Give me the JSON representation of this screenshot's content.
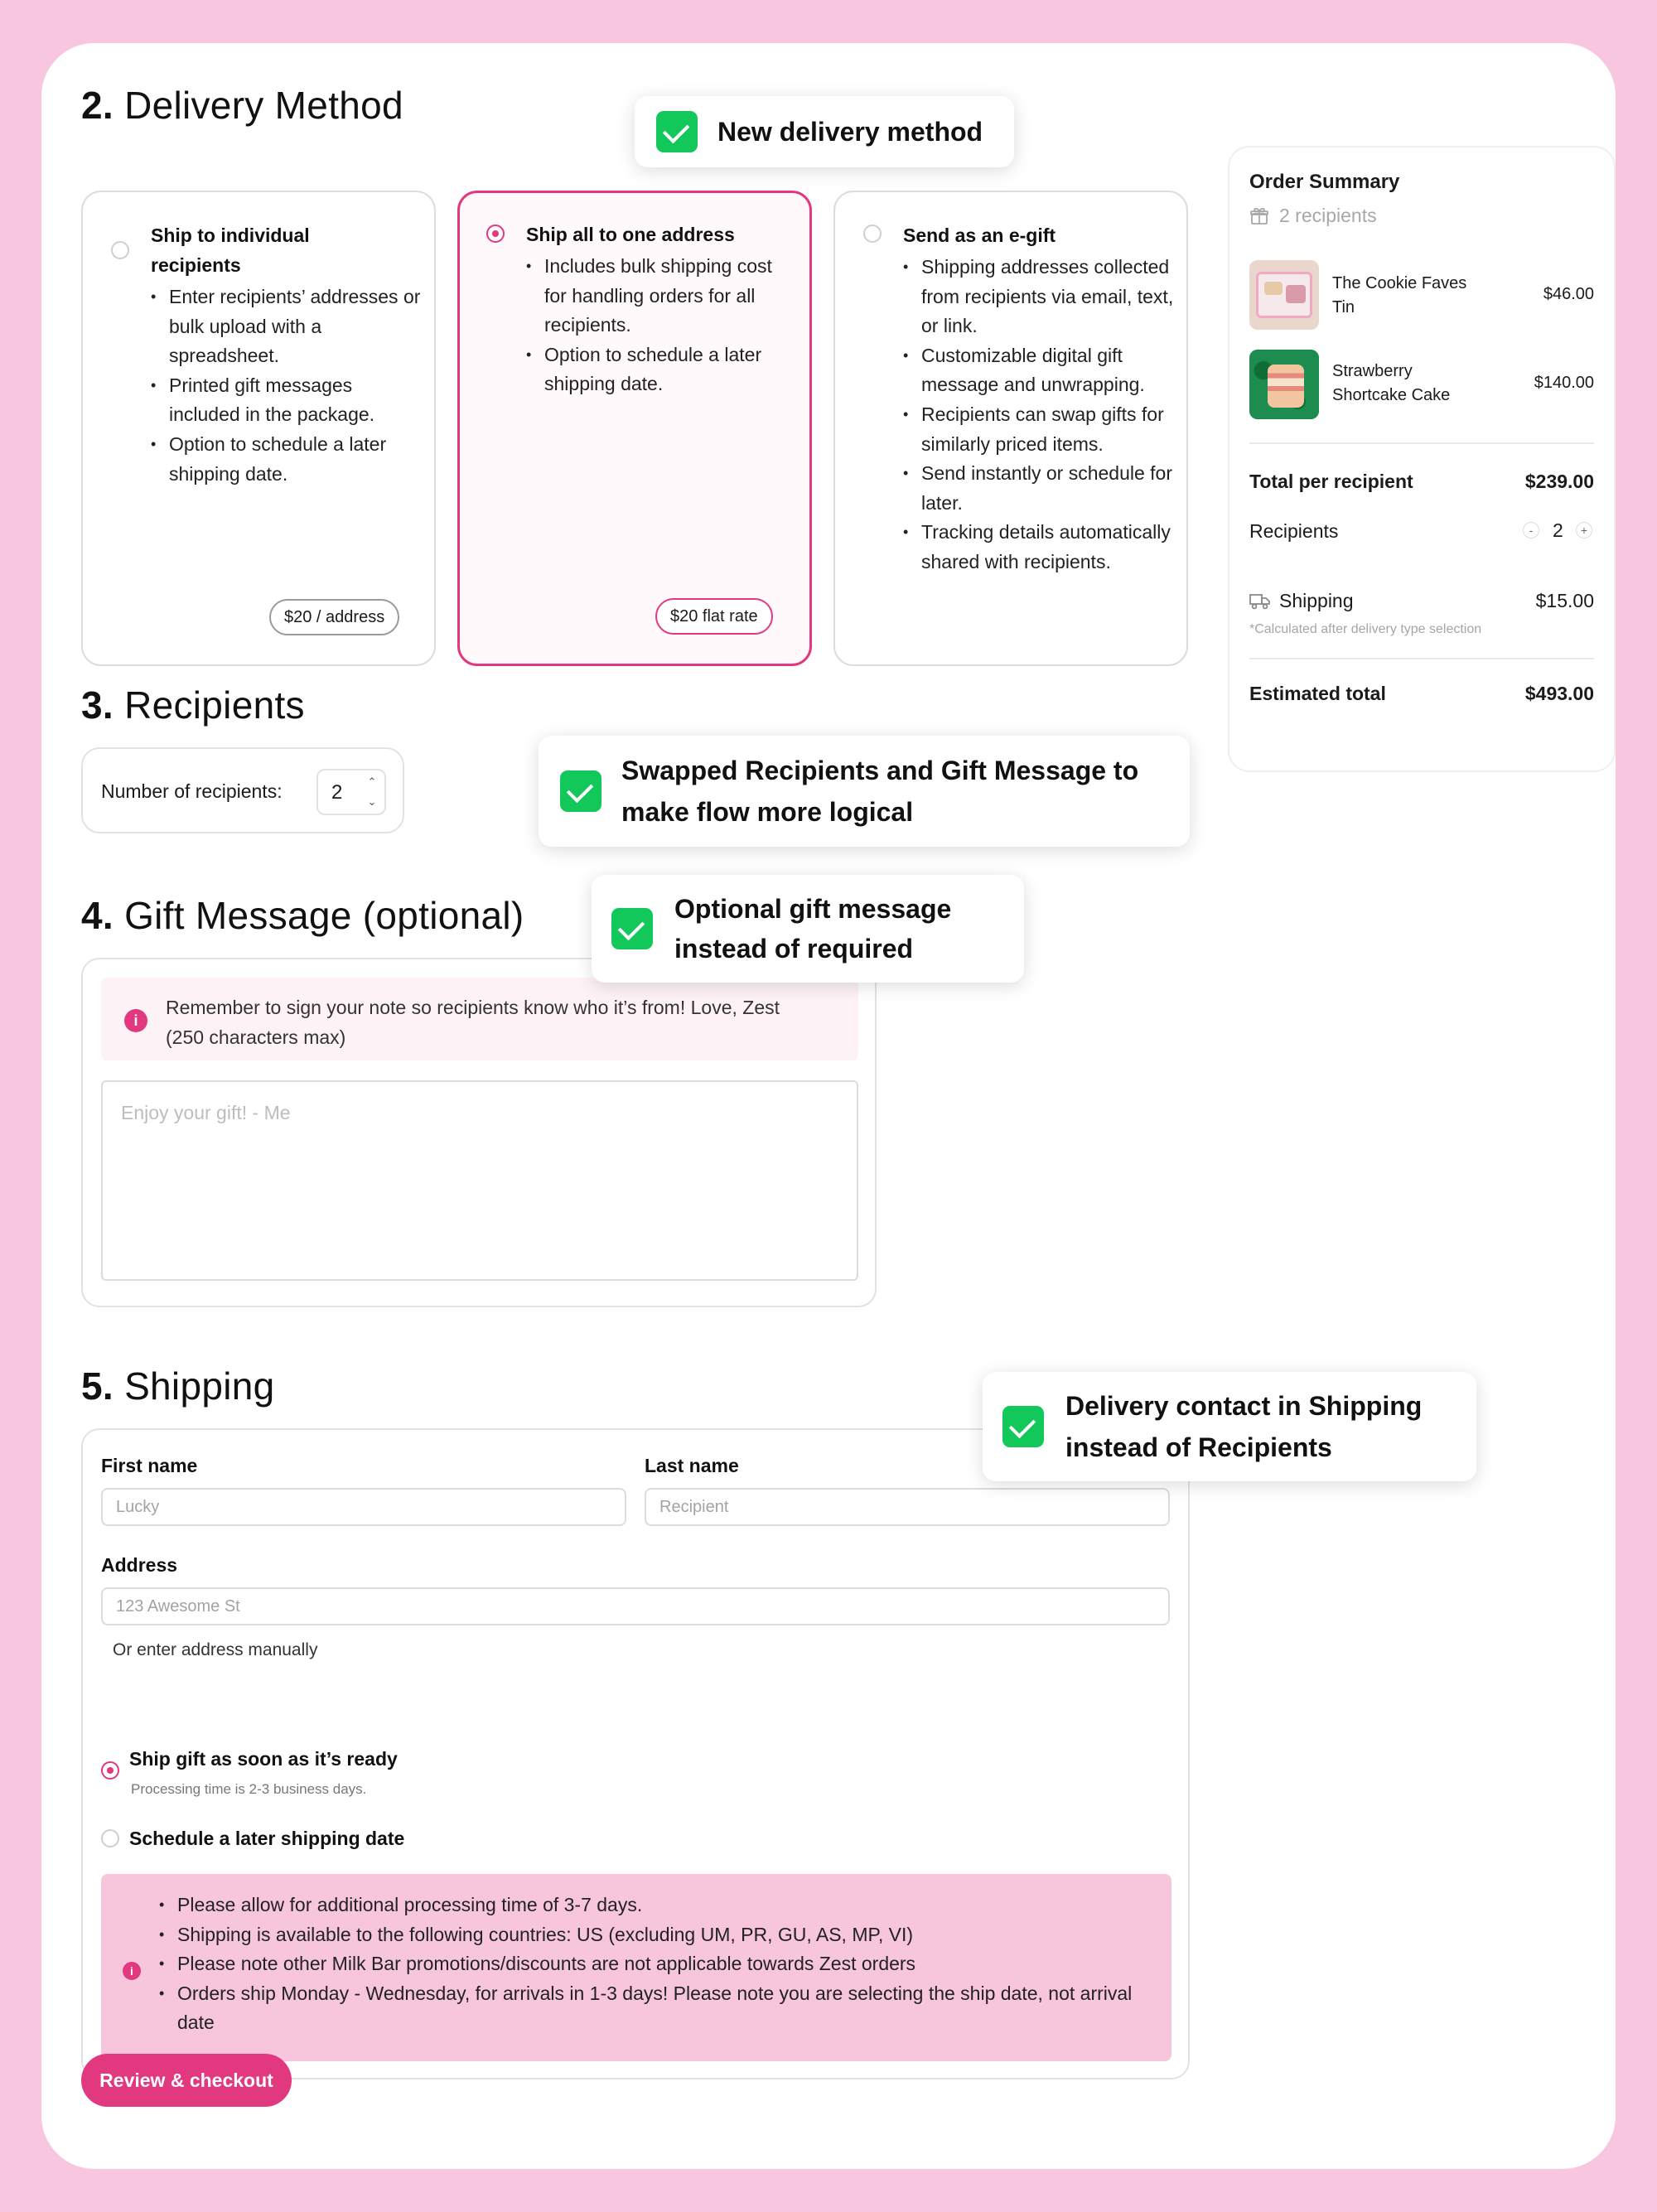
{
  "delivery": {
    "heading_num": "2.",
    "heading_text": "Delivery Method",
    "options": [
      {
        "title_l1": "Ship to individual",
        "title_l2": "recipients",
        "bullets": [
          "Enter recipients’ addresses or bulk upload with a spreadsheet.",
          "Printed gift messages included in the package.",
          "Option to schedule a later shipping date."
        ],
        "price": "$20 / address"
      },
      {
        "title": "Ship all to one address",
        "bullets": [
          "Includes bulk shipping cost for handling orders for all recipients.",
          "Option to schedule a later shipping date."
        ],
        "price": "$20 flat rate"
      },
      {
        "title": "Send as an e-gift",
        "bullets": [
          "Shipping addresses collected from recipients via email, text, or link.",
          "Customizable digital gift message and unwrapping.",
          "Recipients can swap gifts for similarly priced items.",
          "Send instantly or schedule for later.",
          "Tracking details automatically shared with recipients."
        ]
      }
    ]
  },
  "notes": {
    "new_delivery": "New delivery method",
    "swapped_l1": "Swapped Recipients and Gift Message to",
    "swapped_l2": "make flow more logical",
    "optional_l1": "Optional gift message",
    "optional_l2": "instead of required",
    "contact_l1": "Delivery contact in Shipping",
    "contact_l2": "instead of Recipients"
  },
  "recipients": {
    "heading_num": "3.",
    "heading_text": "Recipients",
    "label": "Number of recipients:",
    "value": "2"
  },
  "gift": {
    "heading_num": "4.",
    "heading_text": "Gift Message (optional)",
    "info_l1": "Remember to sign your note so recipients know who it’s from! Love, Zest",
    "info_l2": "(250 characters max)",
    "placeholder": "Enjoy your gift! - Me"
  },
  "shipping": {
    "heading_num": "5.",
    "heading_text": "Shipping",
    "first_label": "First name",
    "first_placeholder": "Lucky",
    "last_label": "Last name",
    "last_placeholder": "Recipient",
    "address_label": "Address",
    "address_placeholder": "123 Awesome St",
    "manual_link": "Or enter address manually",
    "asap_label": "Ship gift as soon as it’s ready",
    "asap_sub": "Processing time is 2-3 business days.",
    "later_label": "Schedule a later shipping date",
    "info_bullets": [
      "Please allow for additional processing time of 3-7 days.",
      "Shipping is available to the following countries: US (excluding UM, PR, GU, AS, MP, VI)",
      "Please note other Milk Bar promotions/discounts are not applicable towards Zest orders",
      "Orders ship Monday - Wednesday, for arrivals in 1-3 days! Please note you are selecting the ship date, not arrival date"
    ]
  },
  "cta": "Review & checkout",
  "summary": {
    "title": "Order Summary",
    "recipients": "2 recipients",
    "items": [
      {
        "name_l1": "The Cookie Faves",
        "name_l2": "Tin",
        "price": "$46.00"
      },
      {
        "name_l1": "Strawberry",
        "name_l2": "Shortcake Cake",
        "price": "$140.00"
      }
    ],
    "total_per_label": "Total per recipient",
    "total_per_value": "$239.00",
    "recipients_label": "Recipients",
    "recipients_value": "2",
    "shipping_label": "Shipping",
    "shipping_value": "$15.00",
    "shipping_note": "*Calculated after delivery type selection",
    "estimated_label": "Estimated total",
    "estimated_value": "$493.00"
  },
  "colors": {
    "background": "#f8c6df",
    "accent": "#e2387f",
    "check": "#12c85a",
    "info_tint": "#fdf2f6",
    "info_strong": "#f7c6dc"
  },
  "icons": [
    "check-icon",
    "gift-icon",
    "truck-icon",
    "info-icon",
    "chevron-up-icon",
    "chevron-down-icon",
    "minus-icon",
    "plus-icon"
  ]
}
